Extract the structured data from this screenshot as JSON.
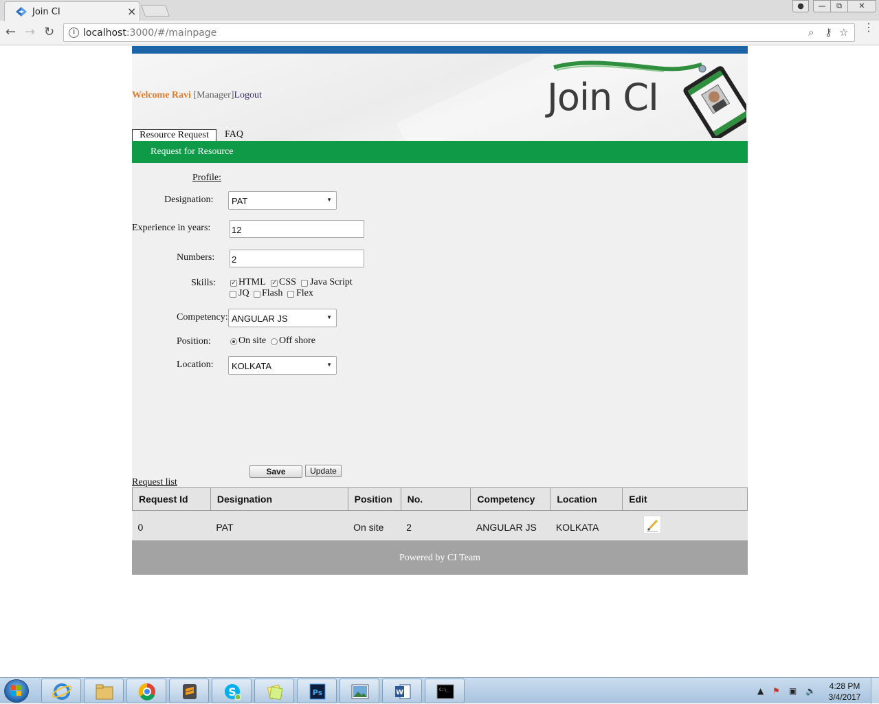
{
  "browser": {
    "tab_title": "Join CI",
    "tab_close": "×",
    "url_host": "localhost",
    "url_path": ":3000/#/mainpage",
    "icons": [
      "back-arrow-icon",
      "forward-arrow-icon",
      "reload-icon",
      "info-icon",
      "zoom-icon",
      "key-icon",
      "star-icon",
      "menu-icon"
    ]
  },
  "header": {
    "welcome": "Welcome Ravi",
    "role": " [Manager]",
    "logout": "Logout",
    "logo_text": "Join CI"
  },
  "nav": {
    "tabs": [
      {
        "label": "Resource Request"
      },
      {
        "label": "FAQ"
      }
    ]
  },
  "section": {
    "title": "Request for Resource"
  },
  "form": {
    "profile_label": "Profile:",
    "designation": {
      "label": "Designation:",
      "value": "PAT"
    },
    "experience": {
      "label": "Experience in years:",
      "value": "12"
    },
    "numbers": {
      "label": "Numbers:",
      "value": "2"
    },
    "skills": {
      "label": "Skills:",
      "options": [
        {
          "label": "HTML",
          "checked": true
        },
        {
          "label": "CSS",
          "checked": true
        },
        {
          "label": "Java Script",
          "checked": false
        },
        {
          "label": "JQ",
          "checked": false
        },
        {
          "label": "Flash",
          "checked": false
        },
        {
          "label": "Flex",
          "checked": false
        }
      ]
    },
    "competency": {
      "label": "Competency:",
      "value": "ANGULAR JS"
    },
    "position": {
      "label": "Position:",
      "options": [
        {
          "label": "On site",
          "selected": true
        },
        {
          "label": "Off shore",
          "selected": false
        }
      ]
    },
    "location": {
      "label": "Location:",
      "value": "KOLKATA"
    },
    "save_label": "Save",
    "update_label": "Update"
  },
  "request_list": {
    "label": "Request list",
    "headers": [
      "Request Id",
      "Designation",
      "Position",
      "No.",
      "Competency",
      "Location",
      "Edit"
    ],
    "rows": [
      [
        "0",
        "PAT",
        "On site",
        "2",
        "ANGULAR JS",
        "KOLKATA"
      ]
    ]
  },
  "footer": {
    "text": "Powered by CI Team"
  },
  "taskbar": {
    "apps": [
      "internet-explorer-icon",
      "file-explorer-icon",
      "chrome-icon",
      "sublime-text-icon",
      "skype-icon",
      "sticky-notes-icon",
      "photoshop-icon",
      "photo-viewer-icon",
      "word-icon",
      "command-prompt-icon"
    ],
    "clock_time": "4:28 PM",
    "clock_date": "3/4/2017"
  },
  "colors": {
    "top_stripe": "#1d63a8",
    "section_bar": "#0f9a48",
    "welcome_name": "#e07b2b",
    "logout_link": "#3a2a6c",
    "footer": "#a3a3a3"
  }
}
